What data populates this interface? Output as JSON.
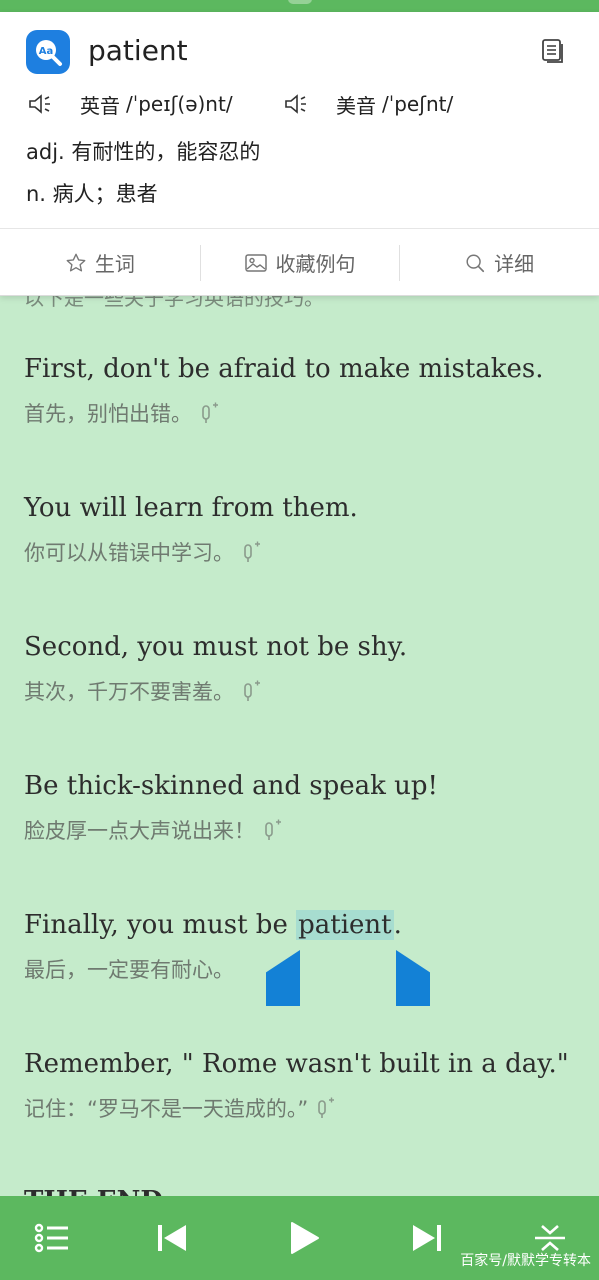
{
  "dict": {
    "word": "patient",
    "uk_label": "英音",
    "uk_phonetic": "/ˈpeɪʃ(ə)nt/",
    "us_label": "美音",
    "us_phonetic": "/ˈpeʃnt/",
    "definitions": [
      "adj. 有耐性的，能容忍的",
      "n. 病人；患者"
    ],
    "tabs": [
      {
        "label": "生词",
        "icon": "star-icon"
      },
      {
        "label": "收藏例句",
        "icon": "image-icon"
      },
      {
        "label": "详细",
        "icon": "search-icon"
      }
    ]
  },
  "content": {
    "cut_line": "以下是一些关于学习英语的技巧。",
    "pairs": [
      {
        "en": "First, don't be afraid to make mistakes.",
        "zh": "首先，别怕出错。"
      },
      {
        "en": "You will learn from them.",
        "zh": "你可以从错误中学习。"
      },
      {
        "en": "Second, you must not be shy.",
        "zh": "其次，千万不要害羞。"
      },
      {
        "en": "Be thick-skinned and speak up!",
        "zh": "脸皮厚一点大声说出来！"
      },
      {
        "en_before": "Finally, you must be ",
        "en_highlight": "patient",
        "en_after": ".",
        "zh": "最后，一定要有耐心。"
      },
      {
        "en": "Remember, \" Rome wasn't built in a day.\"",
        "zh": "记住：“罗马不是一天造成的。”"
      }
    ],
    "the_end": "THE END"
  },
  "toolbar": {
    "buttons": [
      "list-icon",
      "previous-icon",
      "play-icon",
      "next-icon",
      "collapse-icon"
    ]
  },
  "watermark": "百家号/默默学专转本",
  "colors": {
    "background": "#c5ebcb",
    "toolbar": "#5cb85f",
    "highlight": "#a7ddd0",
    "selection_handle": "#1381d6",
    "logo": "#1e7fe0"
  }
}
